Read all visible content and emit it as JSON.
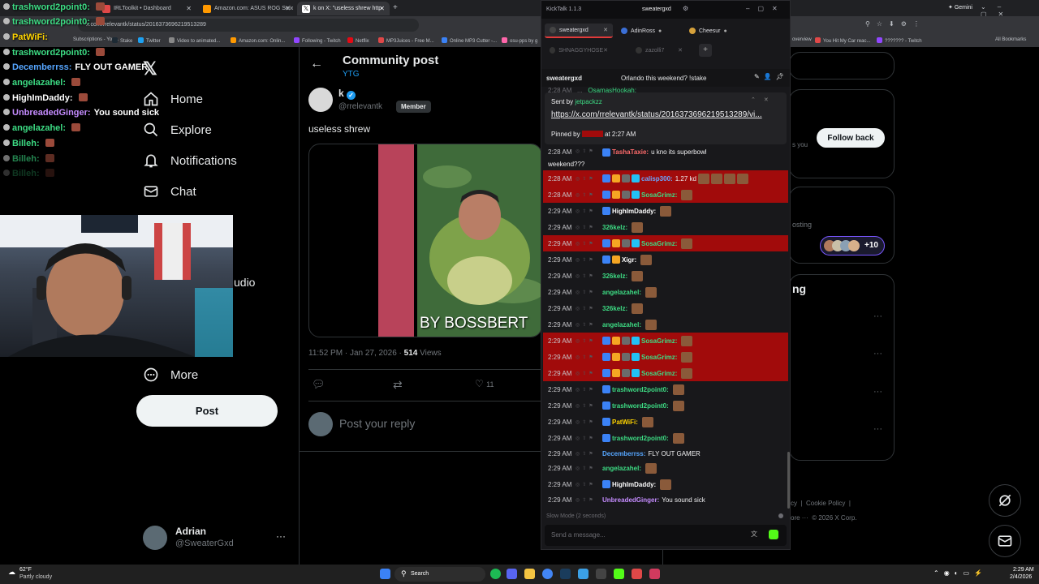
{
  "browser": {
    "tabs": [
      {
        "label": "IRLToolkit • Dashboard",
        "color": "#e04848"
      },
      {
        "label": "Amazon.com: ASUS ROG Strix",
        "color": "#ff9900"
      },
      {
        "label": "k on X: \"useless shrew http",
        "color": "#ffffff"
      }
    ],
    "url": "x.com/rrelevantk/status/2016373696219513289",
    "gemini_label": "Gemini",
    "bookmarks": [
      "Subscriptions - You...",
      "Stake",
      "Twitter",
      "Video to animated...",
      "Amazon.com: Onlin...",
      "Following - Twitch",
      "Netflix",
      "MP3Juices - Free M...",
      "Online MP3 Cutter -...",
      "osu-pps by g"
    ],
    "bookmarks_right": [
      "overview",
      "You Hit My Car reac...",
      "??????? - Twitch",
      "All Bookmarks"
    ]
  },
  "overlay": [
    {
      "user": "trashword2point0:",
      "msg": "",
      "color": "#3ddc84",
      "emote": true
    },
    {
      "user": "trashword2point0:",
      "msg": "",
      "color": "#3ddc84",
      "emote": true
    },
    {
      "user": "PatWiFi:",
      "msg": "",
      "color": "#ffd400",
      "emote": false
    },
    {
      "user": "trashword2point0:",
      "msg": "",
      "color": "#3ddc84",
      "emote": true
    },
    {
      "user": "Decemberrss:",
      "msg": "FLY OUT GAMER",
      "color": "#56a6ff",
      "emote": false
    },
    {
      "user": "angelazahel:",
      "msg": "",
      "color": "#3ddc84",
      "emote": true
    },
    {
      "user": "HighImDaddy:",
      "msg": "",
      "color": "#ffffff",
      "emote": true
    },
    {
      "user": "UnbreadedGinger:",
      "msg": "You sound sick",
      "color": "#c58cff",
      "emote": false
    },
    {
      "user": "angelazahel:",
      "msg": "",
      "color": "#3ddc84",
      "emote": true
    },
    {
      "user": "Billeh:",
      "msg": "",
      "color": "#3ddc84",
      "emote": true
    },
    {
      "user": "Billeh:",
      "msg": "",
      "color": "#3ddc84",
      "emote": true
    },
    {
      "user": "Billeh:",
      "msg": "",
      "color": "#3ddc84",
      "emote": true
    }
  ],
  "x_nav": {
    "home": "Home",
    "explore": "Explore",
    "notifications": "Notifications",
    "chat": "Chat",
    "more": "More",
    "post": "Post",
    "hidden_s": "s",
    "hidden_udio": "udio"
  },
  "account": {
    "name": "Adrian",
    "handle": "@SweaterGxd"
  },
  "community_post": {
    "header": "Community post",
    "community": "YTG",
    "author_name": "k",
    "author_handle": "@rrelevantk",
    "member_badge": "Member",
    "text": "useless shrew",
    "image_caption": "BY BOSSBERT",
    "timestamp": "11:52 PM · Jan 27, 2026 · ",
    "views_count": "514",
    "views_label": " Views",
    "likes": "11",
    "reply_placeholder": "Post your reply"
  },
  "kicktalk": {
    "app_title": "KickTalk 1.1.3",
    "window_user": "sweatergxd",
    "tabs": [
      "sweatergxd",
      "AdinRoss",
      "Cheesur",
      "SHNAGGYHOSE",
      "zazolli7"
    ],
    "channel": "sweatergxd",
    "channel_title": "Orlando this weekend? !stake",
    "pin": {
      "sent_by_label": "Sent by ",
      "sender": "jetpackzz",
      "link": "https://x.com/rrelevantk/status/2016373696219513289/vi...",
      "pinned_by_label": "Pinned by ",
      "pinned_time": " at 2:27 AM"
    },
    "partial_top_user": "OsamasHookah:",
    "messages": [
      {
        "time": "2:28 AM",
        "user": "TashaTaxie:",
        "text": "u kno its superbowl",
        "cont": "weekend???",
        "hl": false,
        "color": "#ff6b6b",
        "emotes": 0
      },
      {
        "time": "2:28 AM",
        "user": "calisp300:",
        "text": "1.27 kd",
        "cont": "",
        "hl": true,
        "color": "#6aa6ff",
        "emotes": 4
      },
      {
        "time": "2:28 AM",
        "user": "SosaGrimz:",
        "text": "",
        "cont": "",
        "hl": true,
        "color": "#3ddc84",
        "emotes": 1
      },
      {
        "time": "2:29 AM",
        "user": "HighImDaddy:",
        "text": "",
        "cont": "",
        "hl": false,
        "color": "#ffffff",
        "emotes": 1
      },
      {
        "time": "2:29 AM",
        "user": "326kelz:",
        "text": "",
        "cont": "",
        "hl": false,
        "color": "#3ddc84",
        "emotes": 1
      },
      {
        "time": "2:29 AM",
        "user": "SosaGrimz:",
        "text": "",
        "cont": "",
        "hl": true,
        "color": "#3ddc84",
        "emotes": 1
      },
      {
        "time": "2:29 AM",
        "user": "Xigr:",
        "text": "",
        "cont": "",
        "hl": false,
        "color": "#ffffff",
        "emotes": 1
      },
      {
        "time": "2:29 AM",
        "user": "326kelz:",
        "text": "",
        "cont": "",
        "hl": false,
        "color": "#3ddc84",
        "emotes": 1
      },
      {
        "time": "2:29 AM",
        "user": "angelazahel:",
        "text": "",
        "cont": "",
        "hl": false,
        "color": "#3ddc84",
        "emotes": 1
      },
      {
        "time": "2:29 AM",
        "user": "326kelz:",
        "text": "",
        "cont": "",
        "hl": false,
        "color": "#3ddc84",
        "emotes": 1
      },
      {
        "time": "2:29 AM",
        "user": "angelazahel:",
        "text": "",
        "cont": "",
        "hl": false,
        "color": "#3ddc84",
        "emotes": 1
      },
      {
        "time": "2:29 AM",
        "user": "SosaGrimz:",
        "text": "",
        "cont": "",
        "hl": true,
        "color": "#3ddc84",
        "emotes": 1
      },
      {
        "time": "2:29 AM",
        "user": "SosaGrimz:",
        "text": "",
        "cont": "",
        "hl": true,
        "color": "#3ddc84",
        "emotes": 1
      },
      {
        "time": "2:29 AM",
        "user": "SosaGrimz:",
        "text": "",
        "cont": "",
        "hl": true,
        "color": "#3ddc84",
        "emotes": 1
      },
      {
        "time": "2:29 AM",
        "user": "trashword2point0:",
        "text": "",
        "cont": "",
        "hl": false,
        "color": "#3ddc84",
        "emotes": 1
      },
      {
        "time": "2:29 AM",
        "user": "trashword2point0:",
        "text": "",
        "cont": "",
        "hl": false,
        "color": "#3ddc84",
        "emotes": 1
      },
      {
        "time": "2:29 AM",
        "user": "PatWiFi:",
        "text": "",
        "cont": "",
        "hl": false,
        "color": "#ffd400",
        "emotes": 1
      },
      {
        "time": "2:29 AM",
        "user": "trashword2point0:",
        "text": "",
        "cont": "",
        "hl": false,
        "color": "#3ddc84",
        "emotes": 1
      },
      {
        "time": "2:29 AM",
        "user": "Decemberrss:",
        "text": "FLY OUT GAMER",
        "cont": "",
        "hl": false,
        "color": "#56a6ff",
        "emotes": 0
      },
      {
        "time": "2:29 AM",
        "user": "angelazahel:",
        "text": "",
        "cont": "",
        "hl": false,
        "color": "#3ddc84",
        "emotes": 1
      },
      {
        "time": "2:29 AM",
        "user": "HighImDaddy:",
        "text": "",
        "cont": "",
        "hl": false,
        "color": "#ffffff",
        "emotes": 1
      },
      {
        "time": "2:29 AM",
        "user": "UnbreadedGinger:",
        "text": "You sound sick",
        "cont": "",
        "hl": false,
        "color": "#c58cff",
        "emotes": 0
      }
    ],
    "slow_mode": "Slow Mode (2 seconds)",
    "input_placeholder": "Send a message..."
  },
  "right_panel": {
    "follow_back": "Follow back",
    "you_partial": "s you",
    "posting_partial": "osting",
    "avatars_count": "+10",
    "ng_partial": "ng",
    "footer_cookie": "Cookie Policy",
    "footer_cy": "cy",
    "footer_ore": "ore ···",
    "footer_copy": "© 2026 X Corp."
  },
  "taskbar": {
    "weather_temp": "62°F",
    "weather_desc": "Partly cloudy",
    "search": "Search",
    "time": "2:29 AM",
    "date": "2/4/2026"
  }
}
